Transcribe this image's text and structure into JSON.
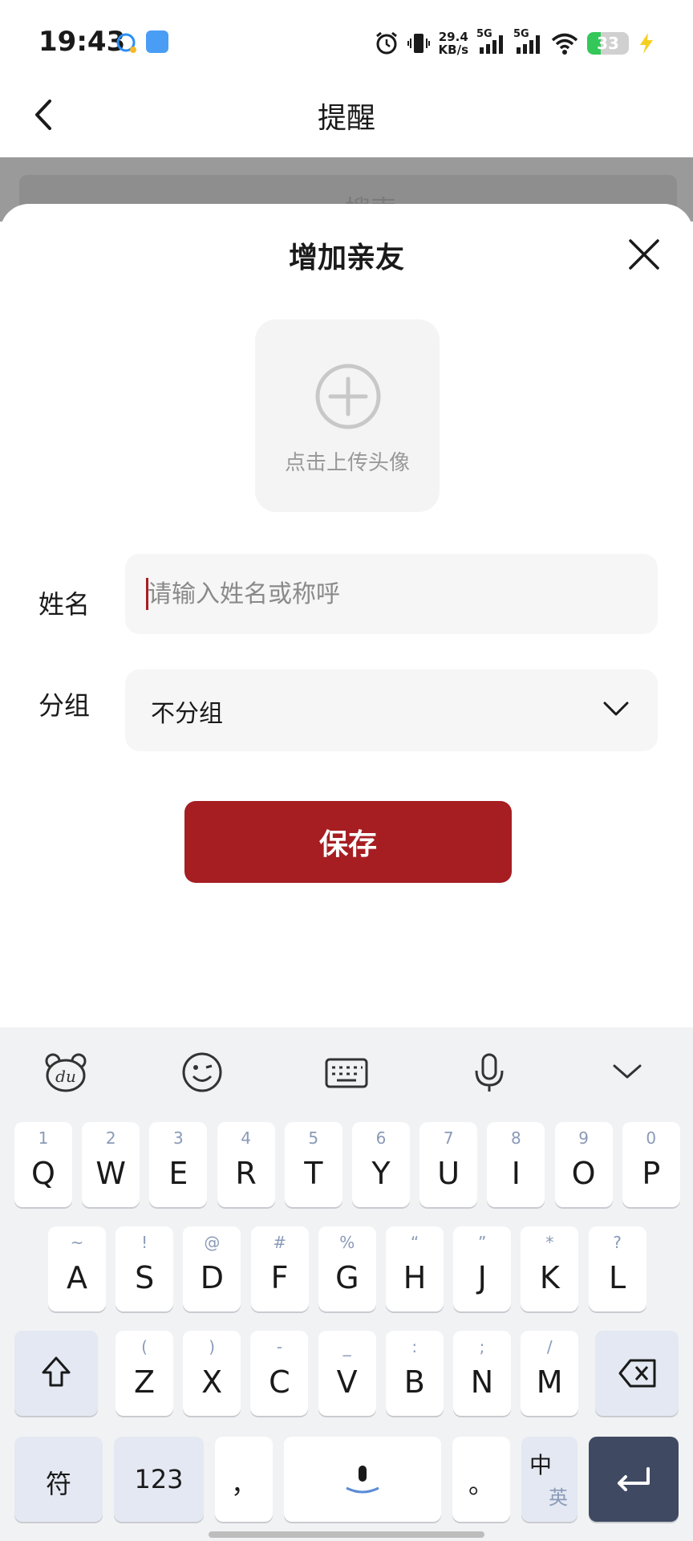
{
  "status_bar": {
    "time": "19:43",
    "net_speed_value": "29.4",
    "net_speed_unit": "KB/s",
    "signal1_label": "5G",
    "signal2_label": "5G",
    "battery_level": "33",
    "battery_fraction": 0.33,
    "icons": [
      "alarm-icon",
      "vibrate-icon",
      "signal-icon",
      "wifi-icon",
      "battery-icon",
      "charging-icon"
    ]
  },
  "header": {
    "title": "提醒"
  },
  "background": {
    "search_label": "搜索"
  },
  "sheet": {
    "title": "增加亲友",
    "avatar_upload_label": "点击上传头像",
    "name_label": "姓名",
    "name_placeholder": "请输入姓名或称呼",
    "name_value": "",
    "group_label": "分组",
    "group_value": "不分组",
    "save_label": "保存"
  },
  "keyboard": {
    "toolbar_icons": [
      "du-bear-icon",
      "emoji-icon",
      "keyboard-icon",
      "microphone-icon",
      "collapse-chevron-icon"
    ],
    "row1": [
      {
        "main": "Q",
        "hint": "1"
      },
      {
        "main": "W",
        "hint": "2"
      },
      {
        "main": "E",
        "hint": "3"
      },
      {
        "main": "R",
        "hint": "4"
      },
      {
        "main": "T",
        "hint": "5"
      },
      {
        "main": "Y",
        "hint": "6"
      },
      {
        "main": "U",
        "hint": "7"
      },
      {
        "main": "I",
        "hint": "8"
      },
      {
        "main": "O",
        "hint": "9"
      },
      {
        "main": "P",
        "hint": "0"
      }
    ],
    "row2": [
      {
        "main": "A",
        "hint": "~"
      },
      {
        "main": "S",
        "hint": "!"
      },
      {
        "main": "D",
        "hint": "@"
      },
      {
        "main": "F",
        "hint": "#"
      },
      {
        "main": "G",
        "hint": "%"
      },
      {
        "main": "H",
        "hint": "“"
      },
      {
        "main": "J",
        "hint": "”"
      },
      {
        "main": "K",
        "hint": "*"
      },
      {
        "main": "L",
        "hint": "?"
      }
    ],
    "row3": [
      {
        "main": "Z",
        "hint": "("
      },
      {
        "main": "X",
        "hint": ")"
      },
      {
        "main": "C",
        "hint": "-"
      },
      {
        "main": "V",
        "hint": "_"
      },
      {
        "main": "B",
        "hint": ":"
      },
      {
        "main": "N",
        "hint": ";"
      },
      {
        "main": "M",
        "hint": "/"
      }
    ],
    "symbols_label": "符",
    "numbers_label": "123",
    "comma_label": "，",
    "period_label": "。",
    "lang_primary": "中",
    "lang_secondary": "英",
    "colors": {
      "enter": "#3f4a62",
      "function_key": "#e3e8f2",
      "accent": "#a61e22"
    }
  }
}
